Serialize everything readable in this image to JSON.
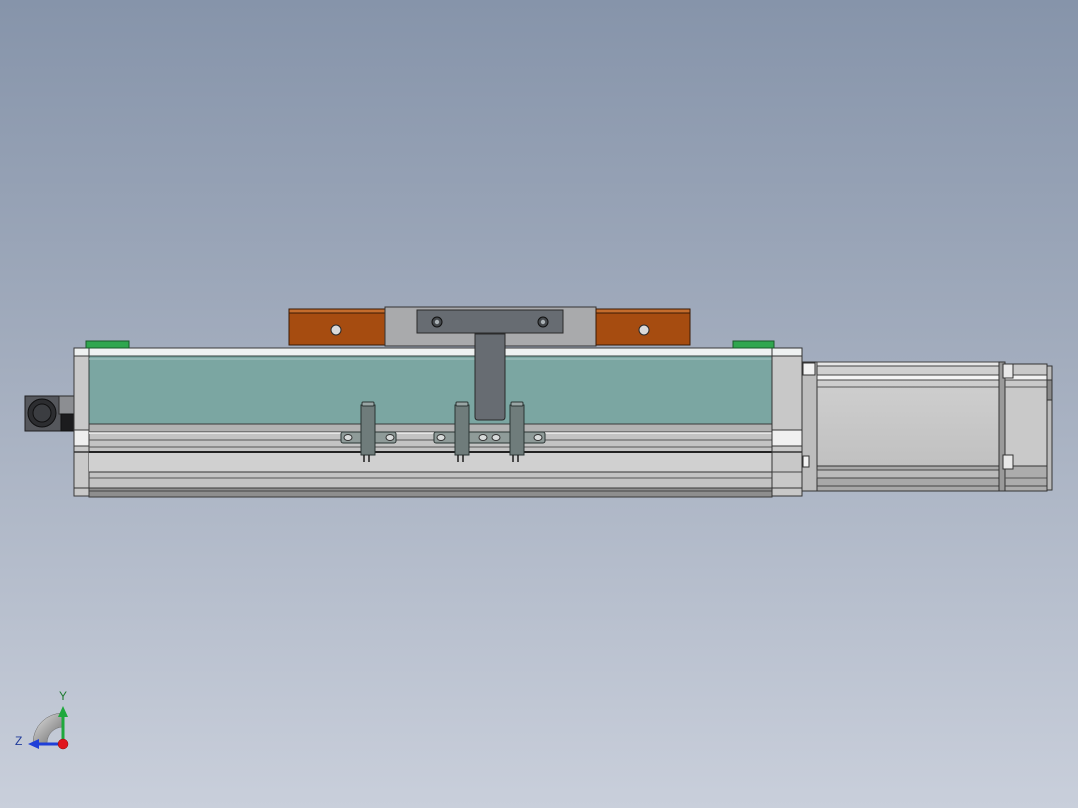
{
  "triad": {
    "y_label": "Y",
    "z_label": "Z"
  },
  "colors": {
    "background_top": "#8694aa",
    "background_bottom": "#c9cfdb",
    "cover": "#7ba6a2",
    "carriage_orange": "#a64c10",
    "carriage_gray": "#a9aaac",
    "plate_dark": "#676c72",
    "limit_block_green": "#2fa64e",
    "triad_x_red": "#e0141c",
    "triad_y_green": "#1ea83c",
    "triad_z_blue": "#1f3fd8"
  }
}
